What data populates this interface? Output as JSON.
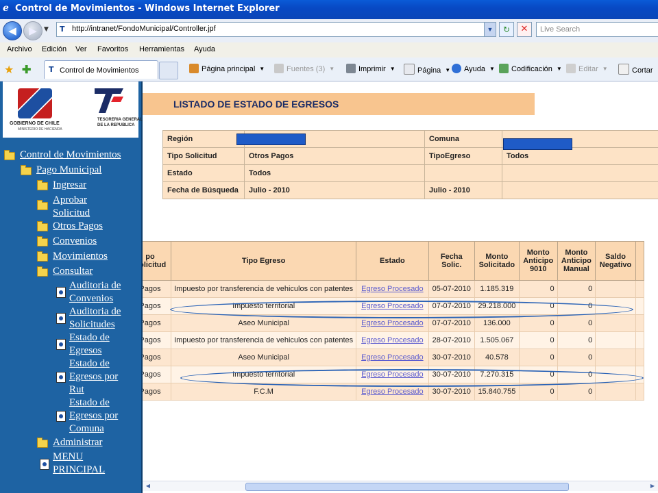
{
  "window": {
    "title": "Control de Movimientos - Windows Internet Explorer"
  },
  "address": {
    "url": "http://intranet/FondoMunicipal/Controller.jpf",
    "search_placeholder": "Live Search"
  },
  "menu": [
    "Archivo",
    "Edición",
    "Ver",
    "Favoritos",
    "Herramientas",
    "Ayuda"
  ],
  "tab": {
    "label": "Control de Movimientos"
  },
  "commands": {
    "home": "Página principal",
    "feeds": "Fuentes (3)",
    "print": "Imprimir",
    "page": "Página",
    "help": "Ayuda",
    "encoding": "Codificación",
    "edit": "Editar",
    "cut": "Cortar"
  },
  "logo": {
    "left_line1": "GOBIERNO DE CHILE",
    "left_line2": "MINISTERIO DE HACIENDA",
    "right_line1": "TESORERIA GENERAL",
    "right_line2": "DE LA REPUBLICA"
  },
  "sidebar": {
    "root": "Control de Movimientos",
    "pago": "Pago Municipal",
    "ingresar": "Ingresar",
    "aprobar": "Aprobar Solicitud",
    "otros": "Otros Pagos",
    "convenios": "Convenios",
    "movimientos": "Movimientos",
    "consultar": "Consultar",
    "sub": {
      "aud_conv": "Auditoria de Convenios",
      "aud_sol": "Auditoria de Solicitudes",
      "estado_egr": "Estado de Egresos",
      "estado_rut": "Estado de Egresos por Rut",
      "estado_comuna": "Estado de Egresos por Comuna"
    },
    "administrar": "Administrar",
    "menu_principal": "MENU PRINCIPAL"
  },
  "page": {
    "title": "LISTADO DE ESTADO DE EGRESOS"
  },
  "filters": {
    "region_label": "Región",
    "comuna_label": "Comuna",
    "tipo_solicitud_label": "Tipo Solicitud",
    "tipo_solicitud_value": "Otros Pagos",
    "tipo_egreso_label": "TipoEgreso",
    "tipo_egreso_value": "Todos",
    "estado_label": "Estado",
    "estado_value": "Todos",
    "fecha_label": "Fecha de Búsqueda",
    "fecha_value": "Julio - 2010",
    "fecha_value2": "Julio - 2010"
  },
  "results": {
    "headers": {
      "tipo_solicitud": "po Solicitud",
      "tipo_egreso": "Tipo Egreso",
      "estado": "Estado",
      "fecha": "Fecha Solic.",
      "monto_sol": "Monto Solicitado",
      "monto_ant": "Monto Anticipo 9010",
      "monto_man": "Monto Anticipo Manual",
      "saldo": "Saldo Negativo"
    },
    "rows": [
      {
        "tipo": "Pagos",
        "egreso": "Impuesto por transferencia de vehiculos con patentes",
        "estado": "Egreso Procesado",
        "fecha": "05-07-2010",
        "monto": "1.185.319",
        "ant": "0",
        "manual": "0"
      },
      {
        "tipo": "Pagos",
        "egreso": "Impuesto territorial",
        "estado": "Egreso Procesado",
        "fecha": "07-07-2010",
        "monto": "29.218.000",
        "ant": "0",
        "manual": "0"
      },
      {
        "tipo": "Pagos",
        "egreso": "Aseo Municipal",
        "estado": "Egreso Procesado",
        "fecha": "07-07-2010",
        "monto": "136.000",
        "ant": "0",
        "manual": "0"
      },
      {
        "tipo": "Pagos",
        "egreso": "Impuesto por transferencia de vehiculos con patentes",
        "estado": "Egreso Procesado",
        "fecha": "28-07-2010",
        "monto": "1.505.067",
        "ant": "0",
        "manual": "0"
      },
      {
        "tipo": "Pagos",
        "egreso": "Aseo Municipal",
        "estado": "Egreso Procesado",
        "fecha": "30-07-2010",
        "monto": "40.578",
        "ant": "0",
        "manual": "0"
      },
      {
        "tipo": "Pagos",
        "egreso": "Impuesto territorial",
        "estado": "Egreso Procesado",
        "fecha": "30-07-2010",
        "monto": "7.270.315",
        "ant": "0",
        "manual": "0"
      },
      {
        "tipo": "Pagos",
        "egreso": "F.C.M",
        "estado": "Egreso Procesado",
        "fecha": "30-07-2010",
        "monto": "15.840.755",
        "ant": "0",
        "manual": "0"
      }
    ]
  },
  "colors": {
    "sidebar_bg": "#1e63a3",
    "banner_bg": "#f8c58f",
    "title_text": "#1b2c66",
    "annotation": "#2a63b6",
    "redaction": "#1f5bc7"
  }
}
